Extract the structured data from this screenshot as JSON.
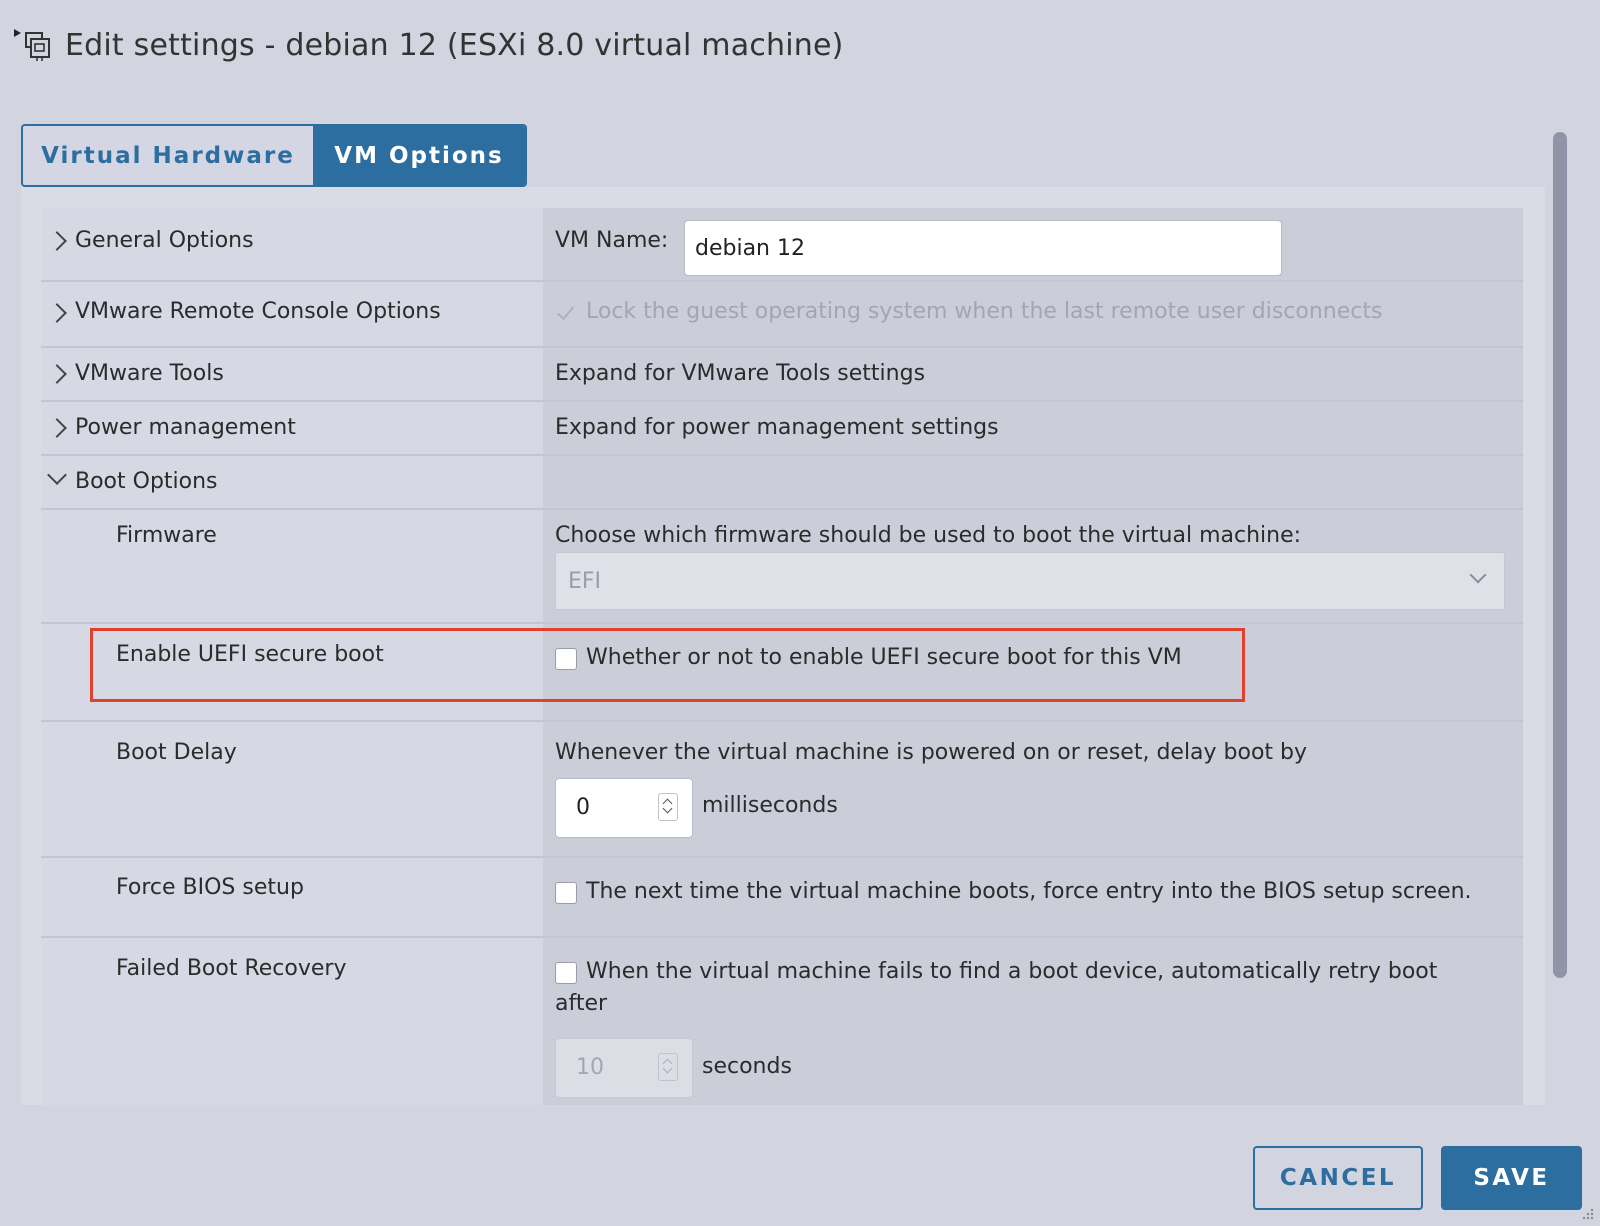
{
  "dialog": {
    "title": "Edit settings - debian 12 (ESXi 8.0 virtual machine)"
  },
  "tabs": [
    {
      "label": "Virtual Hardware"
    },
    {
      "label": "VM Options"
    }
  ],
  "sections": {
    "general": {
      "label": "General Options",
      "vm_name_label": "VM Name:",
      "vm_name_value": "debian 12"
    },
    "remote_console": {
      "label": "VMware Remote Console Options",
      "lock_text": "Lock the guest operating system when the last remote user disconnects"
    },
    "tools": {
      "label": "VMware Tools",
      "text": "Expand for VMware Tools settings"
    },
    "power": {
      "label": "Power management",
      "text": "Expand for power management settings"
    },
    "boot": {
      "label": "Boot Options",
      "firmware": {
        "label": "Firmware",
        "text": "Choose which firmware should be used to boot the virtual machine:",
        "value": "EFI"
      },
      "secure_boot": {
        "label": "Enable UEFI secure boot",
        "text": "Whether or not to enable UEFI secure boot for this VM"
      },
      "boot_delay": {
        "label": "Boot Delay",
        "text": "Whenever the virtual machine is powered on or reset, delay boot by",
        "value": "0",
        "unit": "milliseconds"
      },
      "force_bios": {
        "label": "Force BIOS setup",
        "text": "The next time the virtual machine boots, force entry into the BIOS setup screen."
      },
      "failed_recovery": {
        "label": "Failed Boot Recovery",
        "text_line1": "When the virtual machine fails to find a boot device, automatically retry boot",
        "text_line2": "after",
        "value": "10",
        "unit": "seconds"
      }
    }
  },
  "footer": {
    "cancel_label": "CANCEL",
    "save_label": "SAVE"
  }
}
